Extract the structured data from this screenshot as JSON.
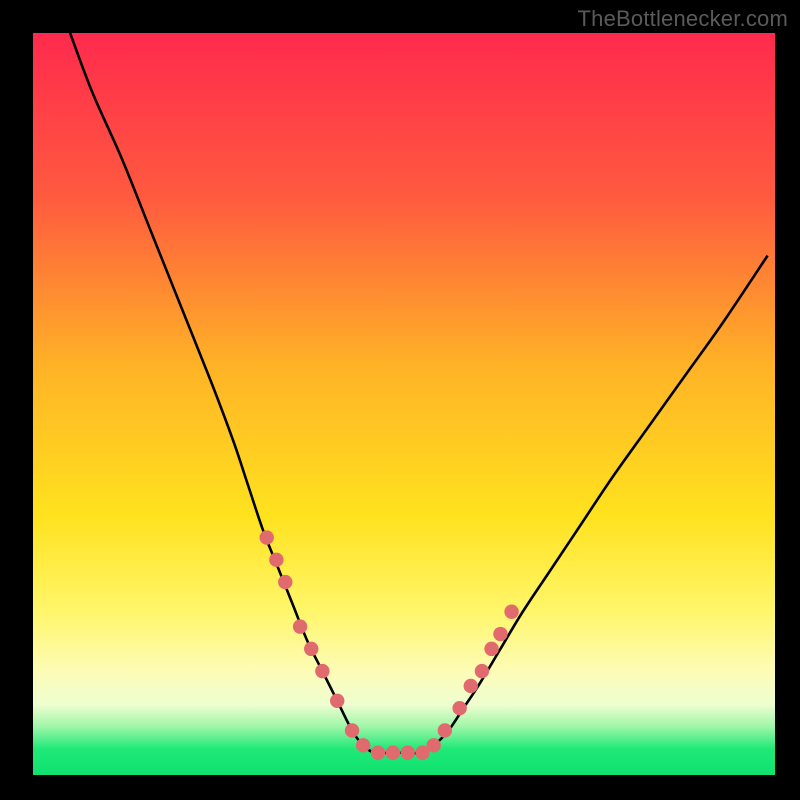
{
  "watermark": {
    "text": "TheBottlenecker.com"
  },
  "colors": {
    "frame_bg": "#000000",
    "curve": "#000000",
    "marker_fill": "#e06a6e",
    "marker_stroke": "#d8585c",
    "green_band": "#12e86a"
  },
  "chart_data": {
    "type": "line",
    "title": "",
    "xlabel": "",
    "ylabel": "",
    "xlim": [
      0,
      100
    ],
    "ylim": [
      0,
      100
    ],
    "gradient_stops": [
      {
        "offset": 0.0,
        "color": "#ff2a4d"
      },
      {
        "offset": 0.22,
        "color": "#ff5a3f"
      },
      {
        "offset": 0.45,
        "color": "#ffb326"
      },
      {
        "offset": 0.65,
        "color": "#ffe21e"
      },
      {
        "offset": 0.78,
        "color": "#fff66b"
      },
      {
        "offset": 0.86,
        "color": "#fdfcb6"
      },
      {
        "offset": 0.905,
        "color": "#eefed0"
      },
      {
        "offset": 0.935,
        "color": "#9ef6a8"
      },
      {
        "offset": 0.965,
        "color": "#1fe977"
      },
      {
        "offset": 1.0,
        "color": "#10e170"
      }
    ],
    "series": [
      {
        "name": "bottleneck-curve",
        "x": [
          5,
          8,
          12,
          16,
          20,
          24,
          27,
          29,
          31,
          33,
          35,
          37,
          39,
          41,
          43,
          44.5,
          46,
          48,
          50,
          52,
          54,
          56,
          58,
          60,
          63,
          66,
          70,
          74,
          78,
          83,
          88,
          93,
          99
        ],
        "y": [
          100,
          92,
          83,
          73,
          63,
          53,
          45,
          39,
          33,
          28,
          23,
          18,
          14,
          10,
          6,
          4,
          3,
          3,
          3,
          3,
          4,
          6,
          9,
          12,
          17,
          22,
          28,
          34,
          40,
          47,
          54,
          61,
          70
        ]
      }
    ],
    "markers": {
      "name": "highlighted-points",
      "x": [
        31.5,
        32.8,
        34.0,
        36.0,
        37.5,
        39.0,
        41.0,
        43.0,
        44.5,
        46.5,
        48.5,
        50.5,
        52.5,
        54.0,
        55.5,
        57.5,
        59.0,
        60.5,
        61.8,
        63.0,
        64.5
      ],
      "y": [
        32,
        29,
        26,
        20,
        17,
        14,
        10,
        6,
        4,
        3,
        3,
        3,
        3,
        4,
        6,
        9,
        12,
        14,
        17,
        19,
        22
      ]
    },
    "annotations": []
  }
}
